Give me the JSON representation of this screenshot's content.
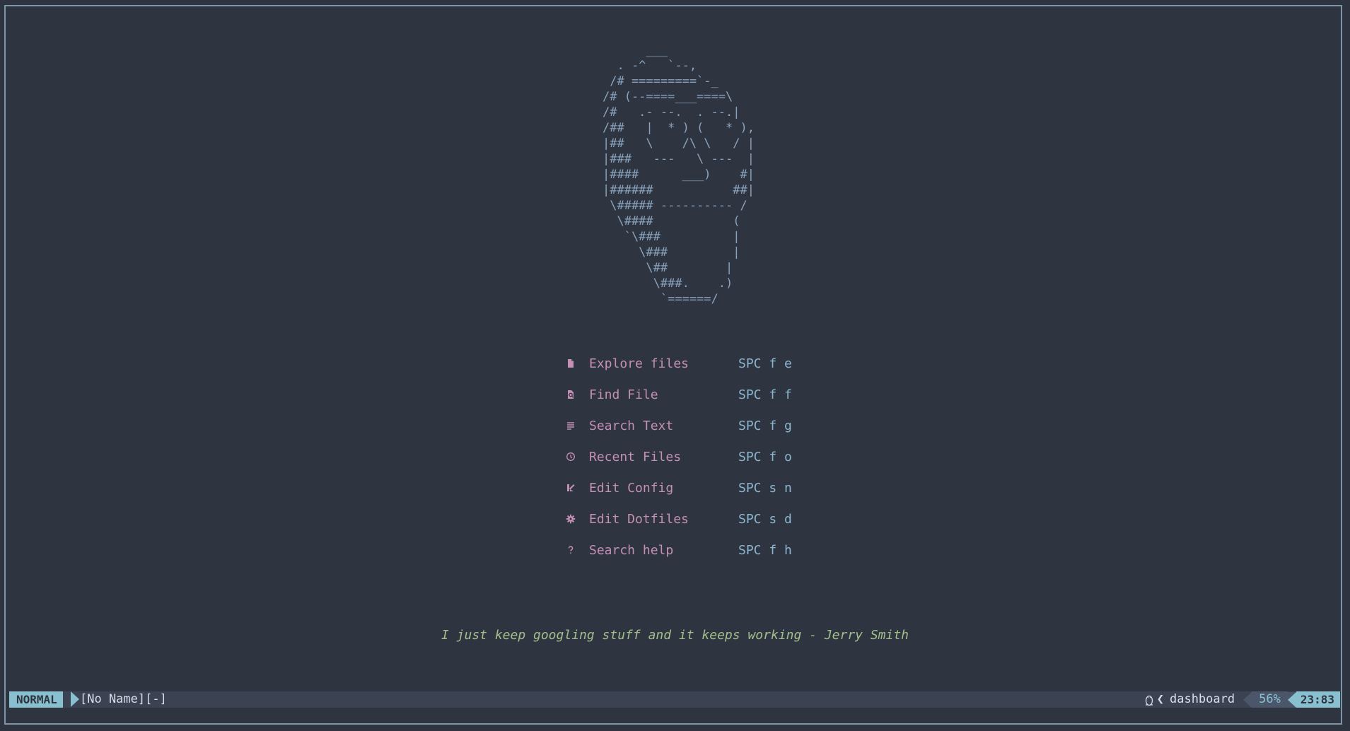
{
  "ascii_art": "      ___\n  . -^   `--,\n /# =========`-_\n/# (--====___====\\\n/#   .- --.  . --.|\n/##   |  * ) (   * ),\n|##   \\    /\\ \\   / |\n|###   ---   \\ ---  |\n|####      ___)    #|\n|######           ##|\n \\##### ---------- /\n  \\####           (\n   `\\###          |\n     \\###         |\n      \\##        |\n       \\###.    .)\n        `======/",
  "menu": [
    {
      "icon": "file-icon",
      "label": "Explore files",
      "key": "SPC f e"
    },
    {
      "icon": "file-search-icon",
      "label": "Find File",
      "key": "SPC f f"
    },
    {
      "icon": "text-lines-icon",
      "label": "Search Text",
      "key": "SPC f g"
    },
    {
      "icon": "clock-icon",
      "label": "Recent Files",
      "key": "SPC f o"
    },
    {
      "icon": "edit-config-icon",
      "label": "Edit Config",
      "key": "SPC s n"
    },
    {
      "icon": "gear-icon",
      "label": "Edit Dotfiles",
      "key": "SPC s d"
    },
    {
      "icon": "question-icon",
      "label": "Search help",
      "key": "SPC f h"
    }
  ],
  "quote": "I just keep googling stuff and it keeps working - Jerry Smith",
  "statusline": {
    "mode": "NORMAL",
    "filename": "[No Name][-]",
    "os_icon": "linux-penguin-icon",
    "filetype": "dashboard",
    "percent": "56%",
    "position": "23:83"
  },
  "colors": {
    "background": "#2e3440",
    "ascii": "#8aa3bd",
    "menu_label": "#c490b5",
    "menu_key": "#8cb6cf",
    "quote": "#a3be8c",
    "mode_bg": "#88c0d0"
  }
}
